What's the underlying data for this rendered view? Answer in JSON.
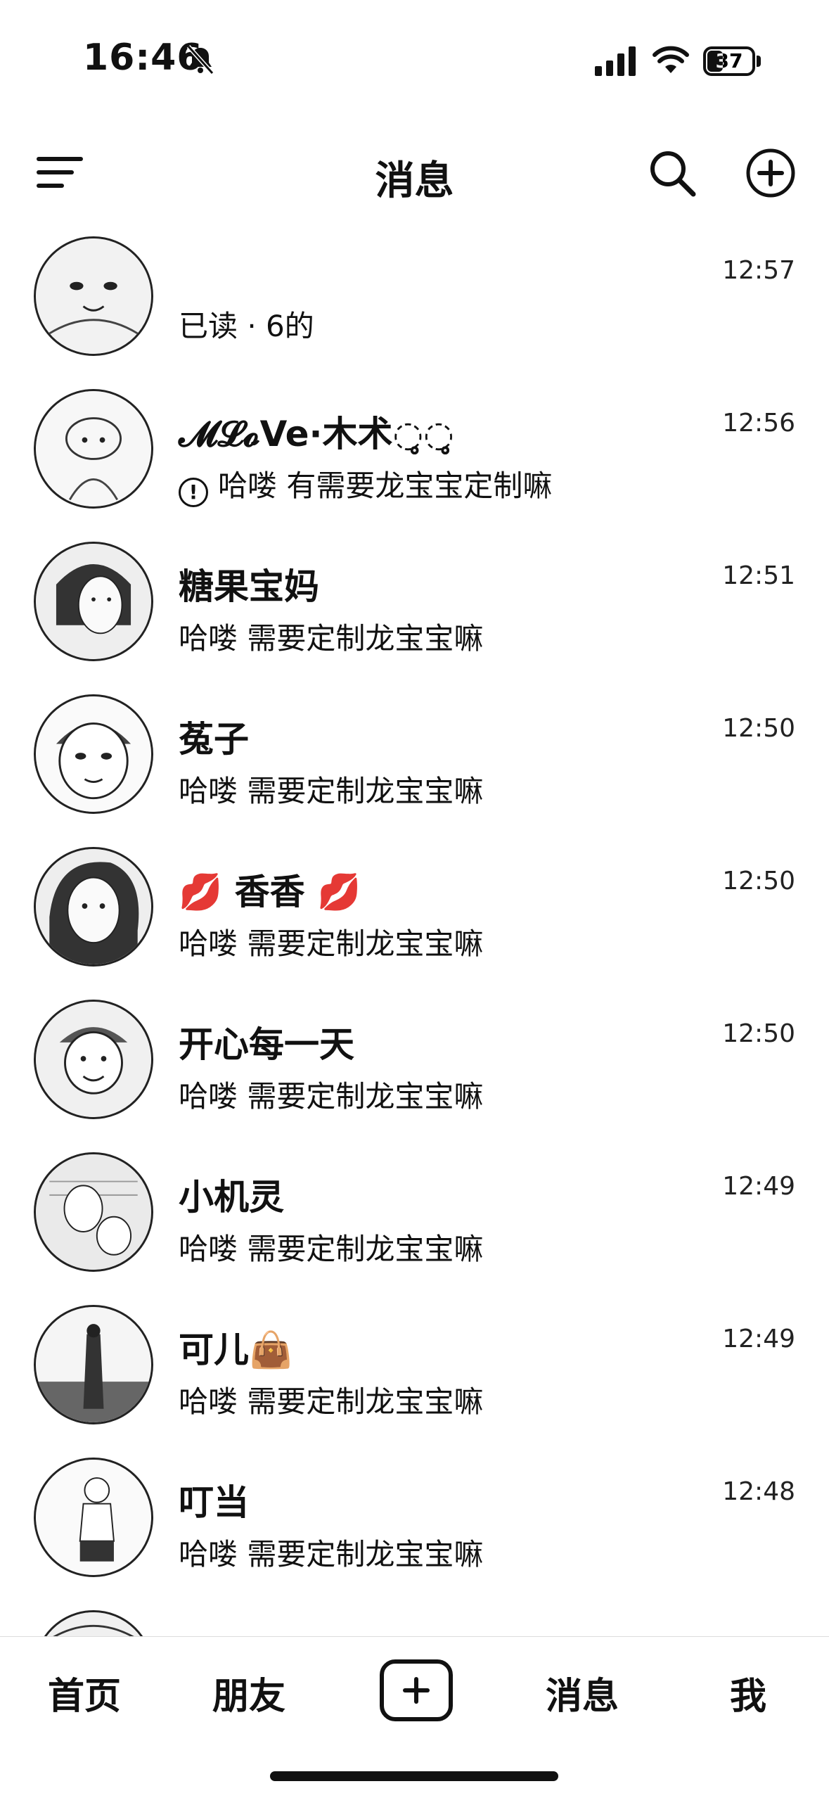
{
  "status_bar": {
    "time": "16:46",
    "battery_level": "37"
  },
  "header": {
    "title": "消息"
  },
  "conversations": [
    {
      "name": "",
      "preview": "已读 · 6的",
      "time": "12:57"
    },
    {
      "name": "𝓜𝓛𝓸Ve·木术◌̥̥◌̥̥",
      "preview": "哈喽 有需要龙宝宝定制嘛",
      "time": "12:56"
    },
    {
      "name": "糖果宝妈",
      "preview": "哈喽 需要定制龙宝宝嘛",
      "time": "12:51"
    },
    {
      "name": "菟子",
      "preview": "哈喽 需要定制龙宝宝嘛",
      "time": "12:50"
    },
    {
      "name": "💋 香香 💋",
      "preview": "哈喽 需要定制龙宝宝嘛",
      "time": "12:50"
    },
    {
      "name": "开心每一天",
      "preview": "哈喽 需要定制龙宝宝嘛",
      "time": "12:50"
    },
    {
      "name": "小机灵",
      "preview": "哈喽 需要定制龙宝宝嘛",
      "time": "12:49"
    },
    {
      "name": "可儿👜",
      "preview": "哈喽 需要定制龙宝宝嘛",
      "time": "12:49"
    },
    {
      "name": "叮当",
      "preview": "哈喽 需要定制龙宝宝嘛",
      "time": "12:48"
    }
  ],
  "tabbar": {
    "home": "首页",
    "friends": "朋友",
    "messages": "消息",
    "me": "我"
  }
}
